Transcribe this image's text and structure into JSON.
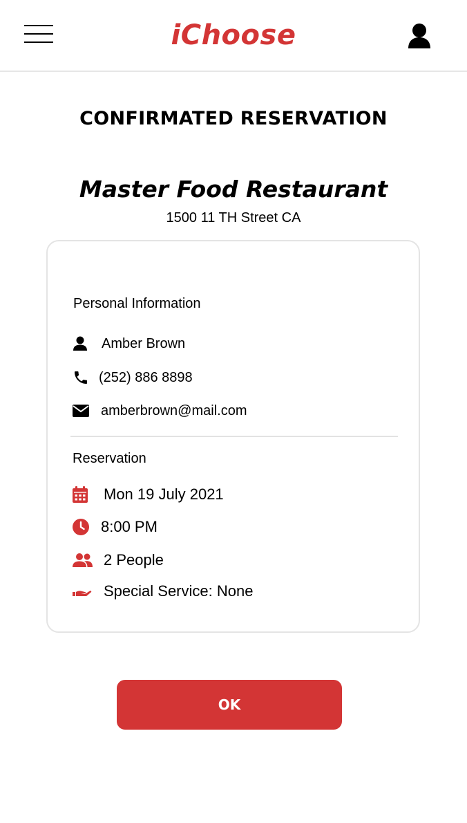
{
  "header": {
    "logo_text": "iChoose",
    "menu_icon": "hamburger-menu-icon",
    "user_icon": "user-icon"
  },
  "page": {
    "title": "CONFIRMATED RESERVATION"
  },
  "restaurant": {
    "name": "Master Food Restaurant",
    "address": "1500 11 TH Street CA"
  },
  "personal_info": {
    "section_title": "Personal Information",
    "name": "Amber Brown",
    "phone": "(252) 886 8898",
    "email": "amberbrown@mail.com"
  },
  "reservation": {
    "section_title": "Reservation",
    "date": "Mon 19 July 2021",
    "time": "8:00 PM",
    "people": "2 People",
    "special_service": "Special Service: None"
  },
  "actions": {
    "ok_label": "OK"
  },
  "colors": {
    "accent": "#d33535",
    "text": "#000000",
    "border": "#e4e4e4"
  }
}
